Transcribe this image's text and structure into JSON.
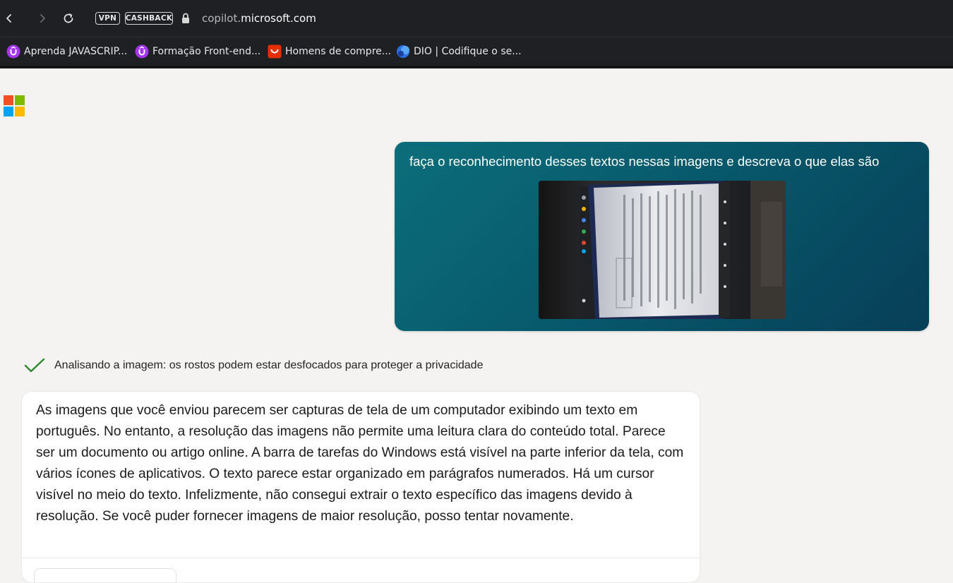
{
  "browser": {
    "url_prefix": "copilot.",
    "url_domain": "microsoft.com",
    "vpn_label": "VPN",
    "cashback_label": "CASHBACK",
    "icons": [
      "back-icon",
      "forward-icon",
      "reload-icon",
      "lock-icon"
    ]
  },
  "bookmarks": [
    {
      "label": "Aprenda JAVASCRIP...",
      "icon": "udemy-icon"
    },
    {
      "label": "Formação Front-end...",
      "icon": "udemy-icon"
    },
    {
      "label": "Homens de compre...",
      "icon": "aliexpress-icon"
    },
    {
      "label": "DIO | Codifique o se...",
      "icon": "dio-icon"
    }
  ],
  "chat": {
    "user_message": "faça o reconhecimento desses textos nessas imagens e descreva o que elas são",
    "status_text": "Analisando a imagem: os rostos podem estar desfocados para proteger a privacidade",
    "response_text": "As imagens que você enviou parecem ser capturas de tela de um computador exibindo um texto em português. No entanto, a resolução das imagens não permite uma leitura clara do conteúdo total. Parece ser um documento ou artigo online. A barra de tarefas do Windows está visível na parte inferior da tela, com vários ícones de aplicativos. O texto parece estar organizado em parágrafos numerados. Há um cursor visível no meio do texto. Infelizmente, não consegui extrair o texto específico das imagens devido à resolução. Se você puder fornecer imagens de maior resolução, posso tentar novamente."
  },
  "colors": {
    "chrome_bg": "#1f2023",
    "page_bg": "#f4f3f2",
    "user_bubble": "#075a6c",
    "check": "#2e8b2e"
  }
}
